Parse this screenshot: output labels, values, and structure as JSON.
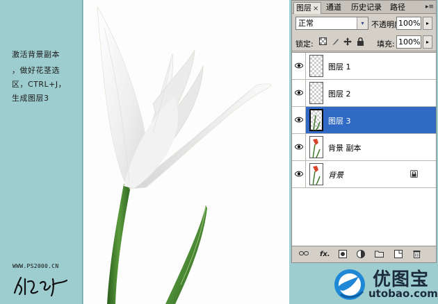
{
  "instructions": {
    "lines": [
      "激活背景副本",
      "，做好花茎选",
      "区，CTRL+J，",
      "生成图层3"
    ],
    "site_url": "WWW.PS2000.CN"
  },
  "tabs": [
    {
      "label": "图层",
      "active": true,
      "close": "×"
    },
    {
      "label": "通道",
      "active": false
    },
    {
      "label": "历史记录",
      "active": false
    },
    {
      "label": "路径",
      "active": false
    }
  ],
  "panel_menu_icon": "panel-menu-icon",
  "blend_mode": {
    "value": "正常",
    "arrow": "▾"
  },
  "opacity": {
    "label": "不透明度:",
    "value": "100%",
    "arrow": "▸"
  },
  "lock": {
    "label": "锁定:",
    "icons": [
      "lock-transparent-icon",
      "lock-paint-icon",
      "lock-move-icon",
      "lock-all-icon"
    ]
  },
  "fill": {
    "label": "填充:",
    "value": "100%",
    "arrow": "▸"
  },
  "layers": [
    {
      "name": "图层 1",
      "selected": false,
      "visible": true,
      "thumb": "transparent",
      "italic": false,
      "locked": false
    },
    {
      "name": "图层 2",
      "selected": false,
      "visible": true,
      "thumb": "transparent",
      "italic": false,
      "locked": false
    },
    {
      "name": "图层 3",
      "selected": true,
      "visible": true,
      "thumb": "transparent",
      "italic": false,
      "locked": false
    },
    {
      "name": "背景 副本",
      "selected": false,
      "visible": true,
      "thumb": "image",
      "italic": false,
      "locked": false
    },
    {
      "name": "背景",
      "selected": false,
      "visible": true,
      "thumb": "image",
      "italic": true,
      "locked": true
    }
  ],
  "bottom_icons": [
    "link-icon",
    "fx-icon",
    "mask-icon",
    "adjustment-icon",
    "folder-icon",
    "new-layer-icon",
    "trash-icon"
  ],
  "watermark": {
    "title": "优图宝",
    "url": "utobao.com"
  },
  "colors": {
    "background": "#9ecdcf",
    "panel": "#d4d0c8",
    "selection": "#316ac5",
    "stem": "#3f7a2b"
  }
}
